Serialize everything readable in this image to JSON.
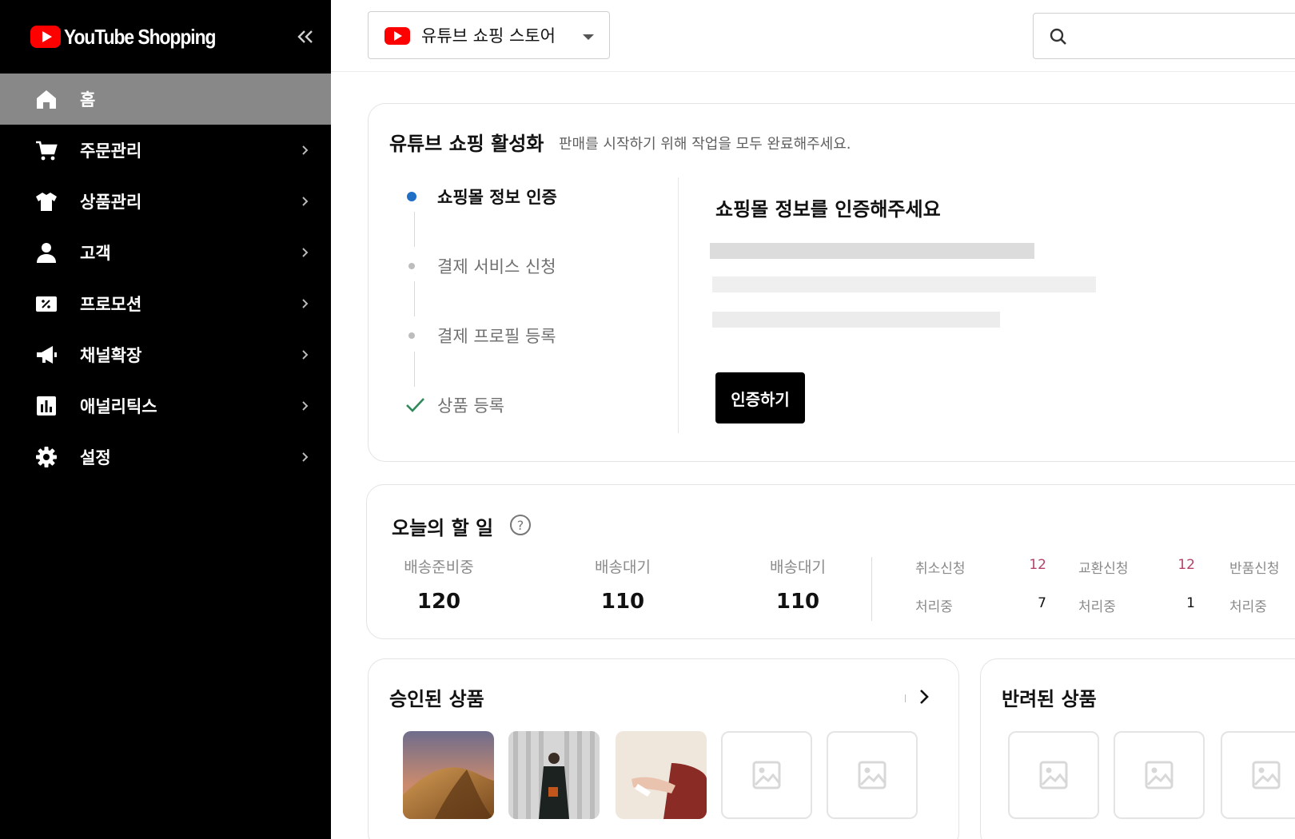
{
  "sidebar": {
    "brand": "YouTube Shopping",
    "items": [
      {
        "label": "홈",
        "icon": "home-icon",
        "active": true
      },
      {
        "label": "주문관리",
        "icon": "cart-icon"
      },
      {
        "label": "상품관리",
        "icon": "shirt-icon"
      },
      {
        "label": "고객",
        "icon": "person-icon"
      },
      {
        "label": "프로모션",
        "icon": "coupon-icon"
      },
      {
        "label": "채널확장",
        "icon": "megaphone-icon"
      },
      {
        "label": "애널리틱스",
        "icon": "bar-chart-icon"
      },
      {
        "label": "설정",
        "icon": "gear-icon"
      }
    ]
  },
  "topbar": {
    "store_name": "유튜브 쇼핑 스토어",
    "search_value": ""
  },
  "activation": {
    "title": "유튜브 쇼핑 활성화",
    "subtitle": "판매를 시작하기 위해 작업을 모두 완료해주세요.",
    "steps": [
      {
        "label": "쇼핑몰 정보 인증",
        "state": "current"
      },
      {
        "label": "결제 서비스 신청",
        "state": "pending"
      },
      {
        "label": "결제 프로필 등록",
        "state": "pending"
      },
      {
        "label": "상품 등록",
        "state": "done"
      }
    ],
    "panel_title": "쇼핑몰 정보를 인증해주세요",
    "button_label": "인증하기"
  },
  "todo": {
    "title": "오늘의 할 일",
    "stats": [
      {
        "label": "배송준비중",
        "value": "120"
      },
      {
        "label": "배송대기",
        "value": "110"
      },
      {
        "label": "배송대기",
        "value": "110"
      }
    ],
    "claims": [
      {
        "label": "취소신청",
        "count": "12",
        "processing_label": "처리중",
        "processing": "7"
      },
      {
        "label": "교환신청",
        "count": "12",
        "processing_label": "처리중",
        "processing": "1"
      },
      {
        "label": "반품신청",
        "count": "",
        "processing_label": "처리중",
        "processing": ""
      }
    ]
  },
  "approved": {
    "title": "승인된 상품",
    "thumbnails": [
      "desert-dune-photo",
      "fashion-model-photo",
      "sandals-photo",
      "image-placeholder-icon",
      "image-placeholder-icon"
    ]
  },
  "rejected": {
    "title": "반려된 상품",
    "thumbnails": [
      "image-placeholder-icon",
      "image-placeholder-icon",
      "image-placeholder-icon"
    ]
  },
  "colors": {
    "sidebar_bg": "#000000",
    "sidebar_active": "#888888",
    "brand_red": "#ff0000",
    "step_current": "#1f6fc5",
    "step_done": "#2f8a5a",
    "claim_count": "#b5426b"
  }
}
